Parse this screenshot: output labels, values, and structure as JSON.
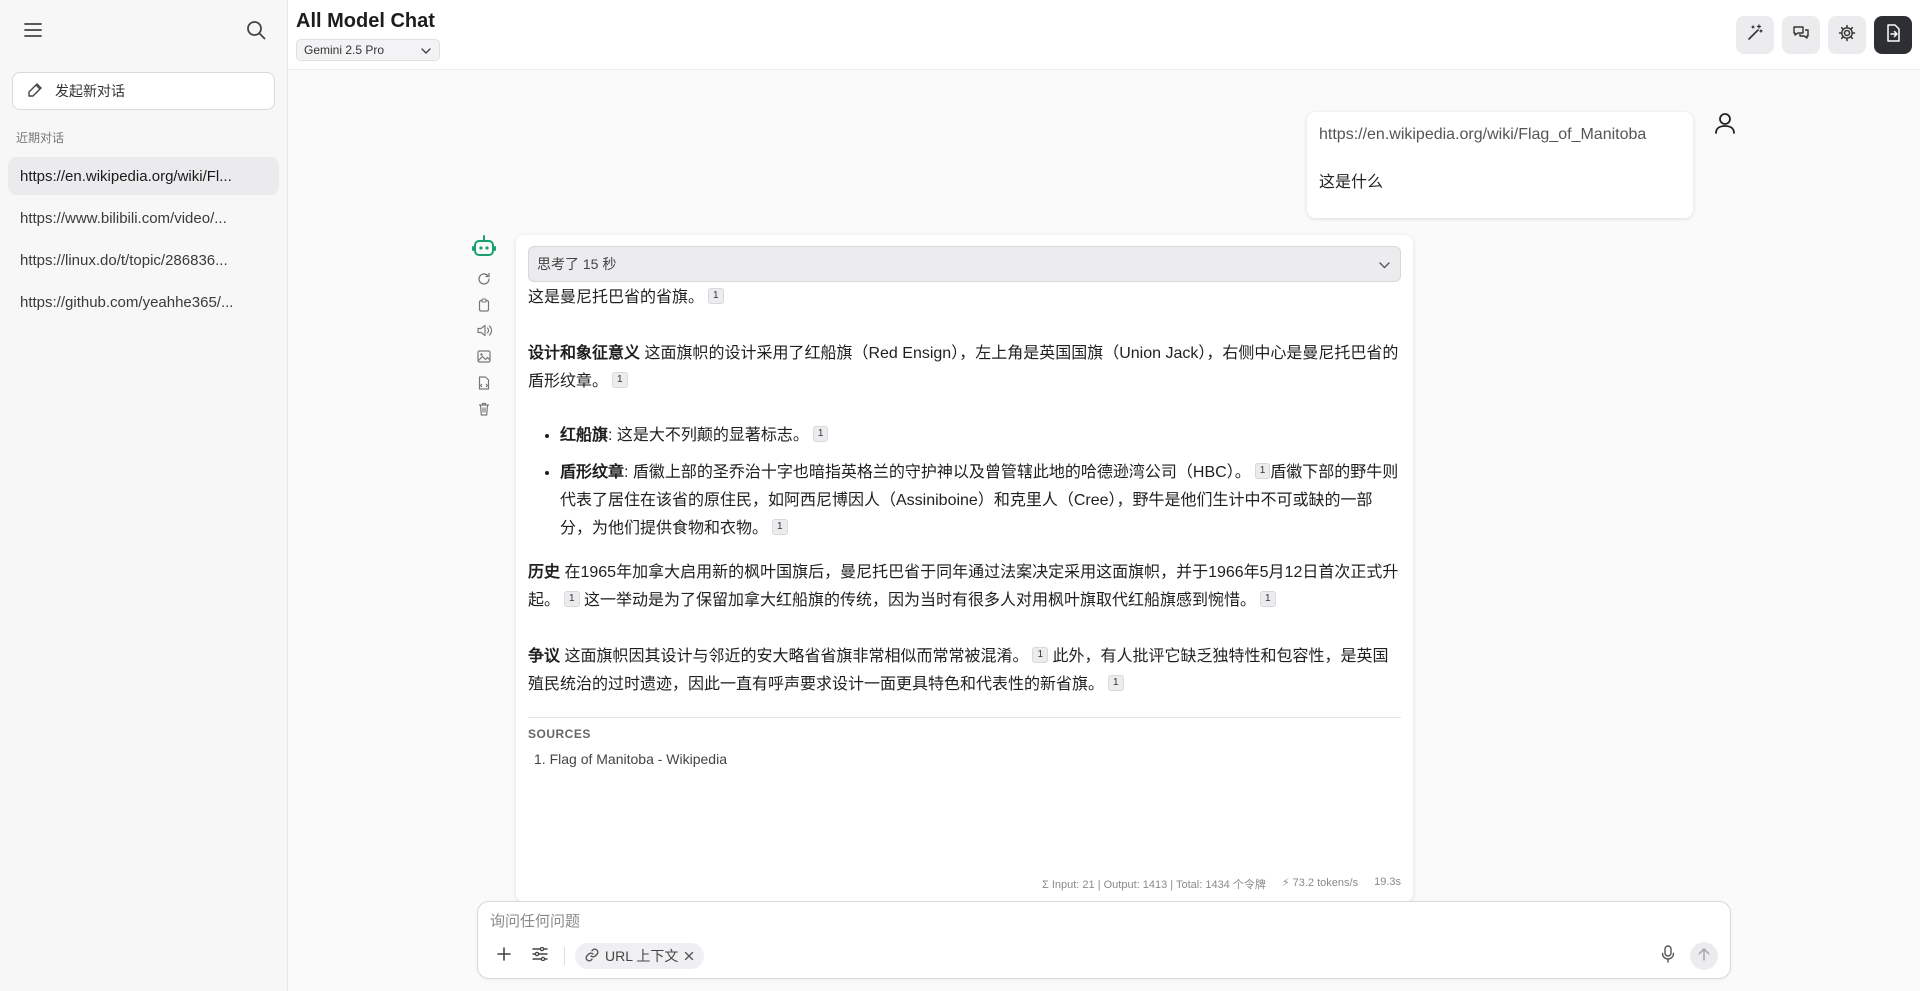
{
  "sidebar": {
    "new_chat_label": "发起新对话",
    "section_label": "近期对话",
    "items": [
      {
        "label": "https://en.wikipedia.org/wiki/Fl..."
      },
      {
        "label": "https://www.bilibili.com/video/..."
      },
      {
        "label": "https://linux.do/t/topic/286836..."
      },
      {
        "label": "https://github.com/yeahhe365/..."
      }
    ]
  },
  "header": {
    "title": "All Model Chat",
    "model": "Gemini 2.5 Pro",
    "actions": [
      "magic-wand-icon",
      "chat-bubbles-icon",
      "gear-icon",
      "export-icon"
    ]
  },
  "user_message": {
    "url": "https://en.wikipedia.org/wiki/Flag_of_Manitoba",
    "question": "这是什么"
  },
  "assistant": {
    "thinking_label": "思考了 15 秒",
    "intro": "这是曼尼托巴省的省旗。",
    "design_title": "设计和象征意义",
    "design_text": "这面旗帜的设计采用了红船旗（Red Ensign），左上角是英国国旗（Union Jack），右侧中心是曼尼托巴省的盾形纹章。",
    "bullets": [
      {
        "title": "红船旗",
        "text": ": 这是大不列颠的显著标志。"
      },
      {
        "title": "盾形纹章",
        "text": ": 盾徽上部的圣乔治十字也暗指英格兰的守护神以及曾管辖此地的哈德逊湾公司（HBC）。",
        "text2": "盾徽下部的野牛则代表了居住在该省的原住民，如阿西尼博因人（Assiniboine）和克里人（Cree），野牛是他们生计中不可或缺的一部分，为他们提供食物和衣物。"
      }
    ],
    "history_title": "历史",
    "history_text": "在1965年加拿大启用新的枫叶国旗后，曼尼托巴省于同年通过法案决定采用这面旗帜，并于1966年5月12日首次正式升起。",
    "history_text2": "这一举动是为了保留加拿大红船旗的传统，因为当时有很多人对用枫叶旗取代红船旗感到惋惜。",
    "controversy_title": "争议",
    "controversy_text": "这面旗帜因其设计与邻近的安大略省省旗非常相似而常常被混淆。",
    "controversy_text2": "此外，有人批评它缺乏独特性和包容性，是英国殖民统治的过时遗迹，因此一直有呼声要求设计一面更具特色和代表性的新省旗。",
    "cite": "1",
    "sources_title": "SOURCES",
    "sources": [
      {
        "num": "1.",
        "label": "Flag of Manitoba - Wikipedia"
      }
    ],
    "stats": {
      "tokens": "Σ Input: 21 | Output: 1413 | Total: 1434 个令牌",
      "speed": "⚡ 73.2 tokens/s",
      "time": "19.3s"
    }
  },
  "composer": {
    "placeholder": "询问任何问题",
    "chip_label": "URL 上下文"
  }
}
